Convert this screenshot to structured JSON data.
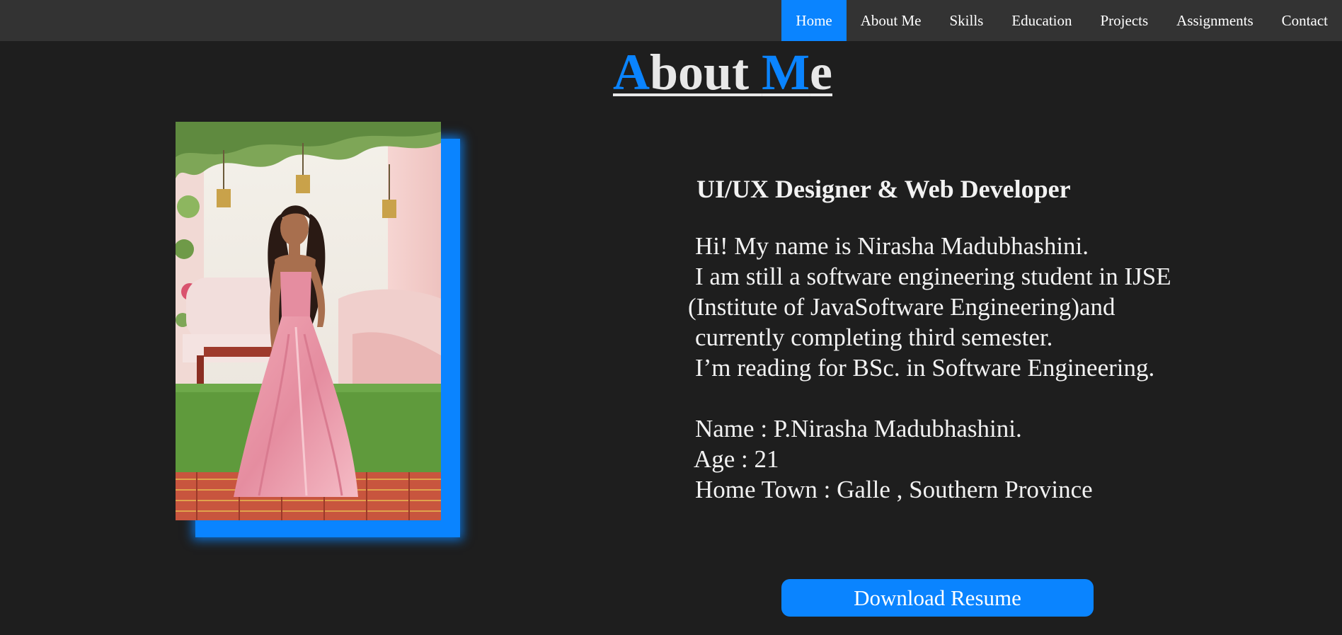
{
  "nav": {
    "items": [
      {
        "label": "Home",
        "active": true
      },
      {
        "label": "About Me",
        "active": false
      },
      {
        "label": "Skills",
        "active": false
      },
      {
        "label": "Education",
        "active": false
      },
      {
        "label": "Projects",
        "active": false
      },
      {
        "label": "Assignments",
        "active": false
      },
      {
        "label": "Contact",
        "active": false
      }
    ]
  },
  "title": {
    "part1_accent": "A",
    "part2": "bout ",
    "part3_accent": "M",
    "part4": "e"
  },
  "profile": {
    "role": "UI/UX Designer & Web Developer",
    "bio": [
      "Hi! My name is Nirasha Madubhashini.",
      "I am still a software engineering student in IJSE",
      "(Institute of JavaSoftware Engineering)and",
      "currently completing third semester.",
      "I’m reading for BSc. in Software Engineering."
    ],
    "details": [
      "Name : P.Nirasha Madubhashini.",
      "Age : 21",
      "Home Town : Galle , Southern Province"
    ]
  },
  "download_button": {
    "label": "Download Resume"
  },
  "colors": {
    "accent": "#0a84ff",
    "background": "#1e1e1e",
    "navbar": "#333333"
  }
}
